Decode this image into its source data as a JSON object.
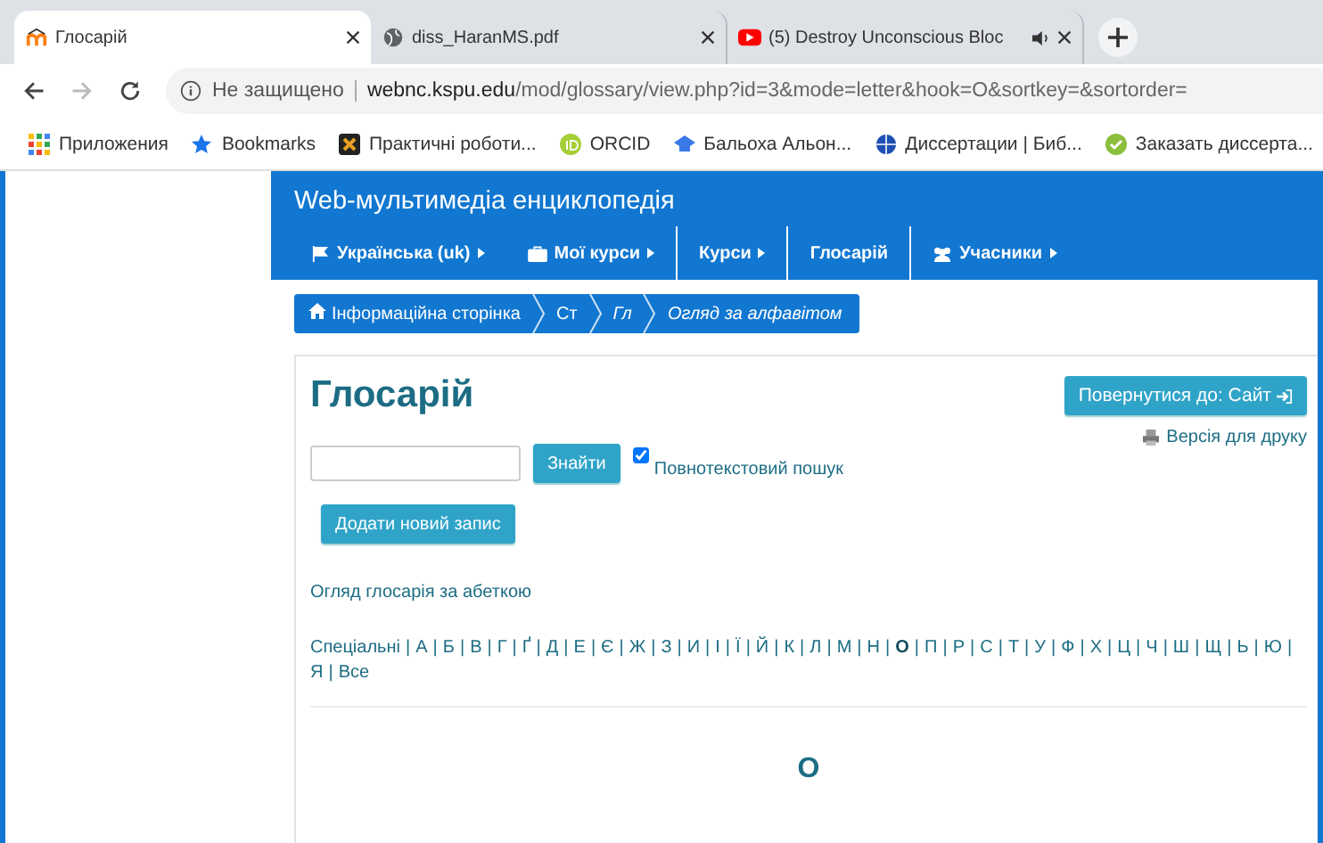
{
  "browser": {
    "tabs": [
      {
        "title": "Глосарій",
        "kind": "moodle",
        "selected": true,
        "audio": false
      },
      {
        "title": "diss_HaranMS.pdf",
        "kind": "globe",
        "selected": false,
        "audio": false
      },
      {
        "title": "(5) Destroy Unconscious Bloc",
        "kind": "video",
        "selected": false,
        "audio": true
      }
    ],
    "security": "Не защищено",
    "url_host": "webnc.kspu.edu",
    "url_path": "/mod/glossary/view.php?id=3&mode=letter&hook=O&sortkey=&sortorder=",
    "bookmarks": [
      {
        "label": "Приложения",
        "kind": "apps"
      },
      {
        "label": "Bookmarks",
        "kind": "star"
      },
      {
        "label": "Практичні роботи...",
        "kind": "tile"
      },
      {
        "label": "ORCID",
        "kind": "orcid"
      },
      {
        "label": "Бальоха Альон...",
        "kind": "cap"
      },
      {
        "label": "Диссертации | Биб...",
        "kind": "globe"
      },
      {
        "label": "Заказать диссерта...",
        "kind": "check"
      }
    ]
  },
  "site": {
    "title": "Web-мультимедіа енциклопедія",
    "nav": [
      {
        "label": "Українська (uk)",
        "kind": "flag",
        "caret": true
      },
      {
        "label": "Мої курси",
        "kind": "briefcase",
        "caret": true
      },
      {
        "label": "Курси",
        "kind": "plain",
        "caret": true
      },
      {
        "label": "Глосарій",
        "kind": "plain",
        "caret": false
      },
      {
        "label": "Учасники",
        "kind": "users",
        "caret": true
      }
    ],
    "breadcrumb": [
      {
        "label": "Інформаційна сторінка",
        "italic": false
      },
      {
        "label": "Ст",
        "italic": false
      },
      {
        "label": "Гл",
        "italic": true
      },
      {
        "label": "Огляд за алфавітом",
        "italic": true
      }
    ]
  },
  "glossary": {
    "heading": "Глосарій",
    "return_button": "Повернутися до: Сайт",
    "print_link": "Версія для друку",
    "search": {
      "button": "Знайти",
      "fulltext_label": "Повнотекстовий пошук",
      "fulltext_checked": true
    },
    "add_button": "Додати новий запис",
    "browse_title": "Огляд глосарія за абеткою",
    "separator": "|",
    "letters": [
      {
        "label": "Спеціальні",
        "selected": false
      },
      {
        "label": "А",
        "selected": false
      },
      {
        "label": "Б",
        "selected": false
      },
      {
        "label": "В",
        "selected": false
      },
      {
        "label": "Г",
        "selected": false
      },
      {
        "label": "Ґ",
        "selected": false
      },
      {
        "label": "Д",
        "selected": false
      },
      {
        "label": "Е",
        "selected": false
      },
      {
        "label": "Є",
        "selected": false
      },
      {
        "label": "Ж",
        "selected": false
      },
      {
        "label": "З",
        "selected": false
      },
      {
        "label": "И",
        "selected": false
      },
      {
        "label": "І",
        "selected": false
      },
      {
        "label": "Ї",
        "selected": false
      },
      {
        "label": "Й",
        "selected": false
      },
      {
        "label": "К",
        "selected": false
      },
      {
        "label": "Л",
        "selected": false
      },
      {
        "label": "М",
        "selected": false
      },
      {
        "label": "Н",
        "selected": false
      },
      {
        "label": "О",
        "selected": true
      },
      {
        "label": "П",
        "selected": false
      },
      {
        "label": "Р",
        "selected": false
      },
      {
        "label": "С",
        "selected": false
      },
      {
        "label": "Т",
        "selected": false
      },
      {
        "label": "У",
        "selected": false
      },
      {
        "label": "Ф",
        "selected": false
      },
      {
        "label": "Х",
        "selected": false
      },
      {
        "label": "Ц",
        "selected": false
      },
      {
        "label": "Ч",
        "selected": false
      },
      {
        "label": "Ш",
        "selected": false
      },
      {
        "label": "Щ",
        "selected": false
      },
      {
        "label": "Ь",
        "selected": false
      },
      {
        "label": "Ю",
        "selected": false
      },
      {
        "label": "Я",
        "selected": false
      },
      {
        "label": "Все",
        "selected": false
      }
    ],
    "section_letter": "О"
  }
}
